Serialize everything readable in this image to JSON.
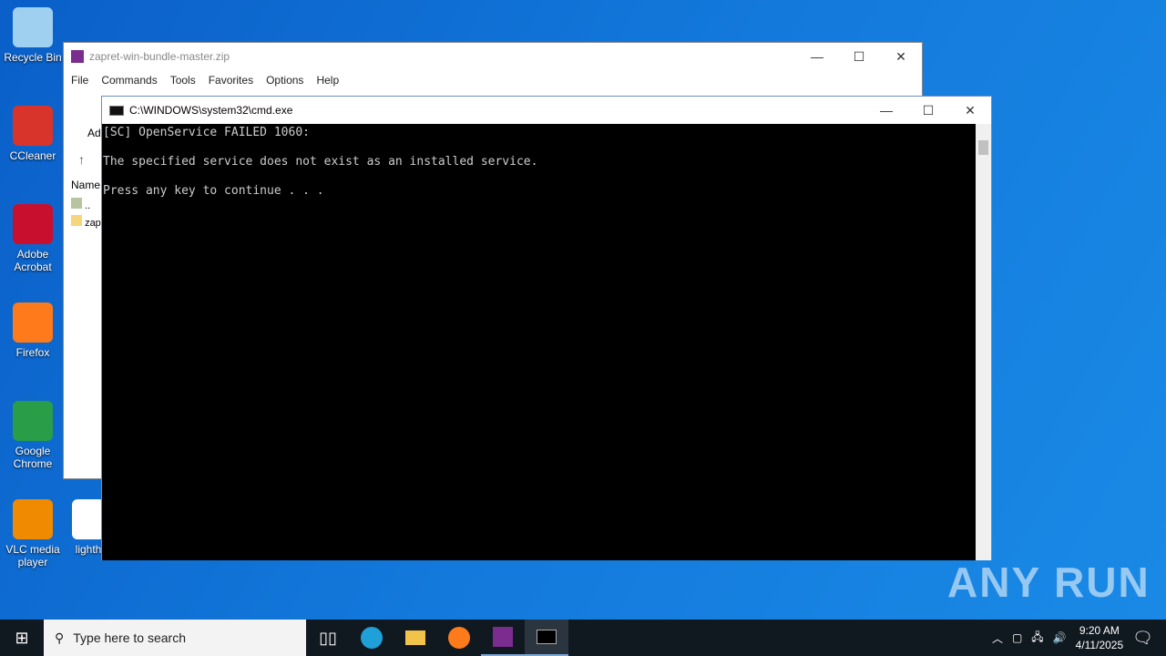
{
  "desktop": {
    "icons": [
      {
        "label": "Recycle Bin",
        "icon": "recycle-bin-icon",
        "color": "#9fd0f0"
      },
      {
        "label": "CCleaner",
        "icon": "ccleaner-icon",
        "color": "#d9342b"
      },
      {
        "label": "Adobe Acrobat",
        "icon": "acrobat-icon",
        "color": "#c8102e"
      },
      {
        "label": "Firefox",
        "icon": "firefox-icon",
        "color": "#ff7a1a"
      },
      {
        "label": "Google Chrome",
        "icon": "chrome-icon",
        "color": "#2a9d48"
      },
      {
        "label": "VLC media player",
        "icon": "vlc-icon",
        "color": "#f08a00"
      }
    ],
    "partial_label": "lighth"
  },
  "winrar": {
    "title": "zapret-win-bundle-master.zip",
    "menu": [
      "File",
      "Commands",
      "Tools",
      "Favorites",
      "Options",
      "Help"
    ],
    "toolbar_partial": "Ad",
    "column_name": "Name",
    "rows": [
      "..",
      "zap"
    ]
  },
  "cmd": {
    "title": "C:\\WINDOWS\\system32\\cmd.exe",
    "lines": [
      "[SC] OpenService FAILED 1060:",
      "",
      "The specified service does not exist as an installed service.",
      "",
      "Press any key to continue . . ."
    ]
  },
  "taskbar": {
    "search_placeholder": "Type here to search",
    "time": "9:20 AM",
    "date": "4/11/2025"
  },
  "watermark": "ANY RUN"
}
